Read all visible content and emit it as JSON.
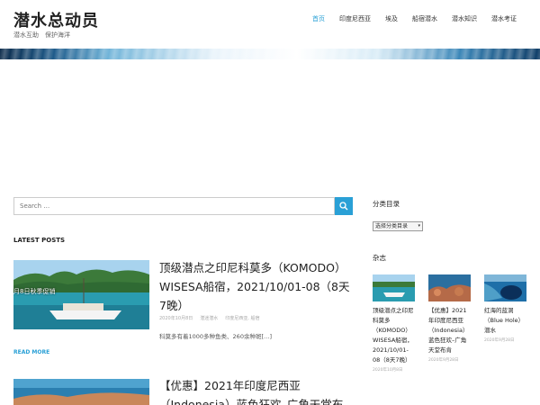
{
  "site": {
    "title": "潜水总动员",
    "description": "潜水互助　保护海洋"
  },
  "nav": [
    {
      "label": "首页",
      "active": true
    },
    {
      "label": "印度尼西亚"
    },
    {
      "label": "埃及"
    },
    {
      "label": "船宿潜水"
    },
    {
      "label": "潜水知识"
    },
    {
      "label": "潜水考证"
    }
  ],
  "search": {
    "placeholder": "Search …"
  },
  "latest_heading": "LATEST POSTS",
  "posts": [
    {
      "image_overlay": "月8日秋季促销",
      "title": "顶级潜点之印尼科莫多（KOMODO）WISESA船宿，2021/10/01-08（8天7晚）",
      "date": "2020年10月8日",
      "author": "潜迷潜水",
      "categories": "印度尼西亚, 船宿",
      "excerpt": "科莫多有着1000多种鱼类、260余种斑[…]",
      "read_more": "READ MORE"
    },
    {
      "title": "【优惠】2021年印度尼西亚（Indonesia）蓝色狂欢–广角天堂布"
    }
  ],
  "sidebar": {
    "categories_title": "分类目录",
    "categories_select": "选择分类目录",
    "magazine_title": "杂志",
    "magazine": [
      {
        "title": "顶级潜点之印尼科莫多（KOMODO）WISESA船宿，2021/10/01-08（8天7晚）",
        "date": "2020年10月8日"
      },
      {
        "title": "【优惠】2021年印度尼西亚（Indonesia）蓝色狂欢–广角天堂布肯",
        "date": "2020年9月28日"
      },
      {
        "title": "红海的蓝洞（Blue Hole）潜水",
        "date": "2020年9月28日"
      }
    ]
  },
  "colors": {
    "accent": "#2aa0d6"
  }
}
